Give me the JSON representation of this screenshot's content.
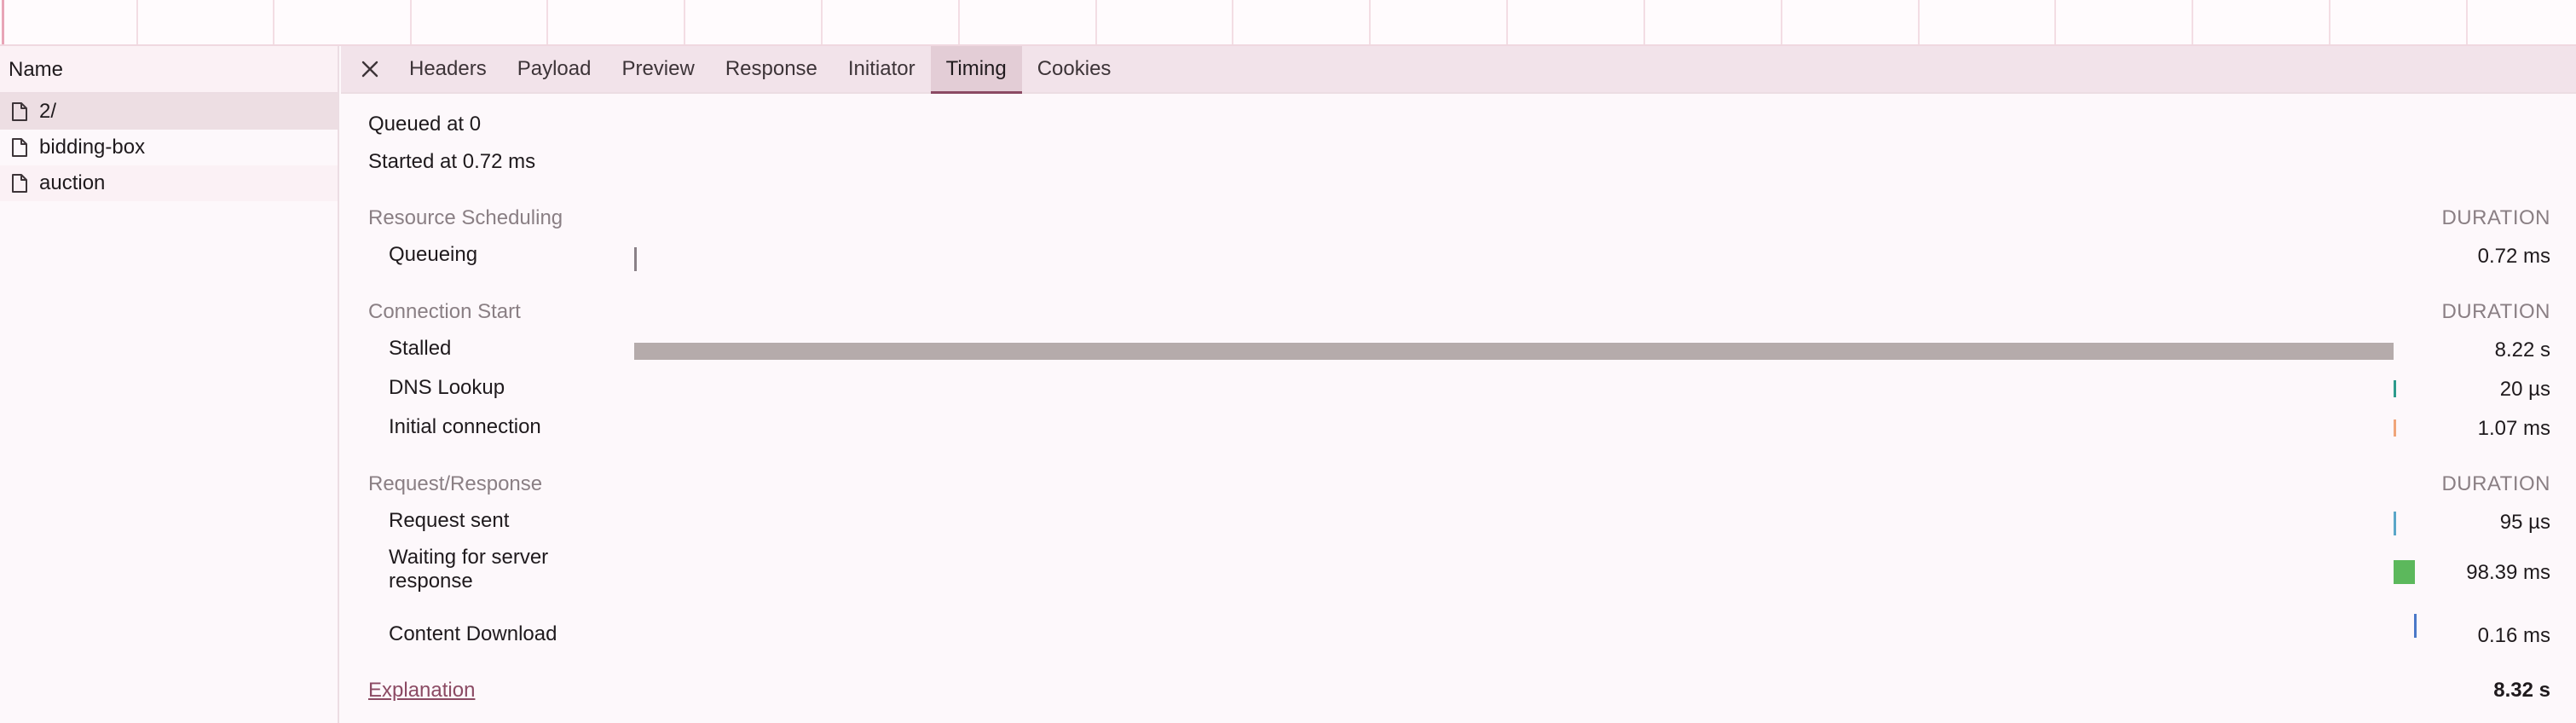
{
  "list": {
    "header": "Name",
    "items": [
      {
        "label": "2/",
        "selected": true
      },
      {
        "label": "bidding-box",
        "selected": false
      },
      {
        "label": "auction",
        "selected": false
      }
    ]
  },
  "tabs": [
    {
      "label": "Headers"
    },
    {
      "label": "Payload"
    },
    {
      "label": "Preview"
    },
    {
      "label": "Response"
    },
    {
      "label": "Initiator"
    },
    {
      "label": "Timing",
      "active": true
    },
    {
      "label": "Cookies"
    }
  ],
  "timing": {
    "queued_at": "Queued at 0",
    "started_at": "Started at 0.72 ms",
    "duration_header": "DURATION",
    "sections": [
      {
        "title": "Resource Scheduling",
        "rows": [
          {
            "label": "Queueing",
            "value": "0.72 ms",
            "color": "#8a8087"
          }
        ]
      },
      {
        "title": "Connection Start",
        "rows": [
          {
            "label": "Stalled",
            "value": "8.22 s",
            "color": "#b5abab"
          },
          {
            "label": "DNS Lookup",
            "value": "20 µs",
            "color": "#2d9b8c"
          },
          {
            "label": "Initial connection",
            "value": "1.07 ms",
            "color": "#f0a57a"
          }
        ]
      },
      {
        "title": "Request/Response",
        "rows": [
          {
            "label": "Request sent",
            "value": "95 µs",
            "color": "#5aa6c8"
          },
          {
            "label": "Waiting for server response",
            "value": "98.39 ms",
            "color": "#5cb85c"
          },
          {
            "label": "Content Download",
            "value": "0.16 ms",
            "color": "#4a78c8"
          }
        ]
      }
    ],
    "explanation": "Explanation",
    "total": "8.32 s"
  }
}
